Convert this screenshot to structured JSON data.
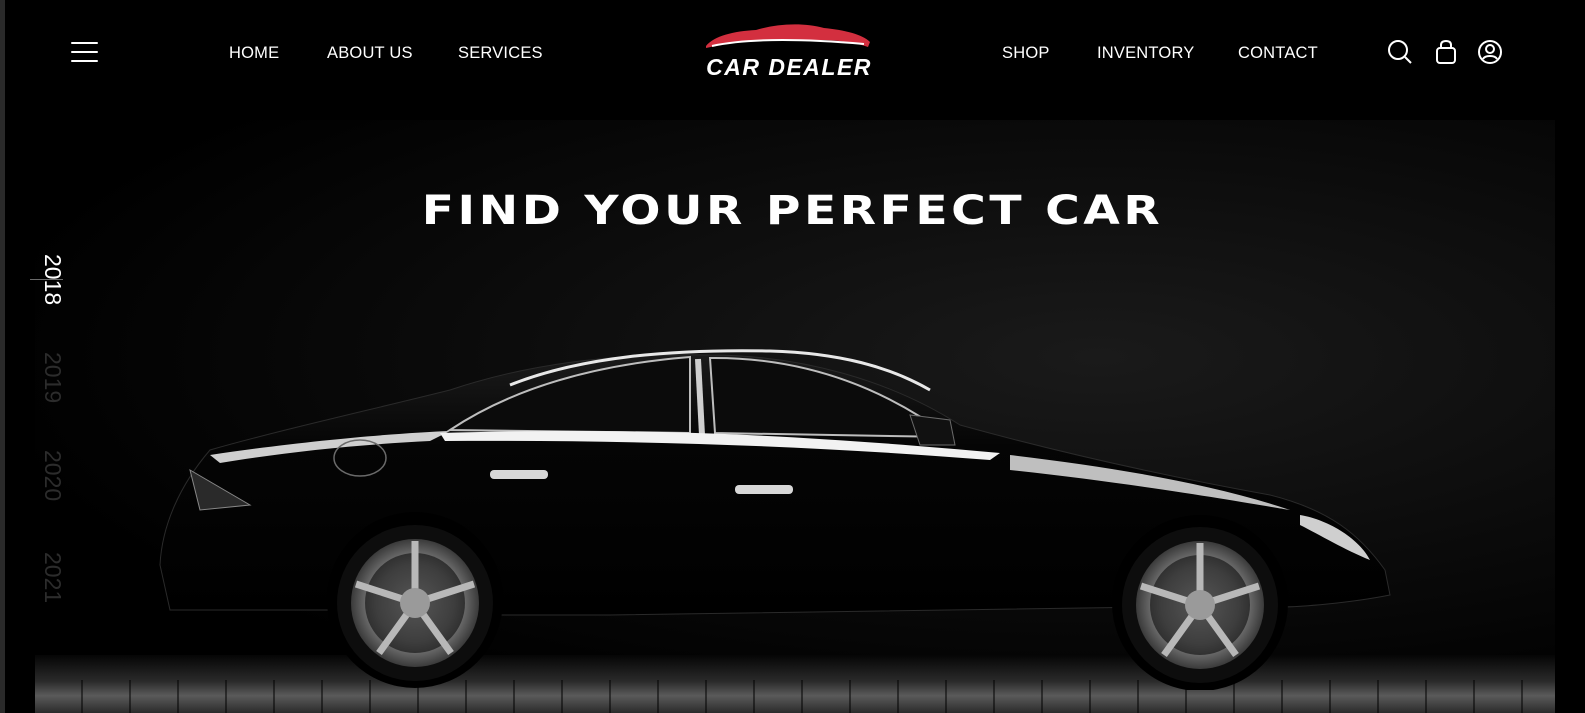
{
  "nav": {
    "left_links": [
      "HOME",
      "ABOUT US",
      "SERVICES"
    ],
    "right_links": [
      "SHOP",
      "INVENTORY",
      "CONTACT"
    ]
  },
  "logo": {
    "text": "CAR DEALER",
    "accent_color": "#d32f3f"
  },
  "hero": {
    "title": "FIND YOUR PERFECT CAR"
  },
  "years": [
    "2018",
    "2019",
    "2020",
    "2021"
  ],
  "active_year": "2018",
  "icons": [
    "menu-icon",
    "search-icon",
    "shopping-bag-icon",
    "user-icon"
  ],
  "colors": {
    "background": "#000000",
    "text": "#ffffff",
    "inactive_year": "#2c2c2c"
  }
}
